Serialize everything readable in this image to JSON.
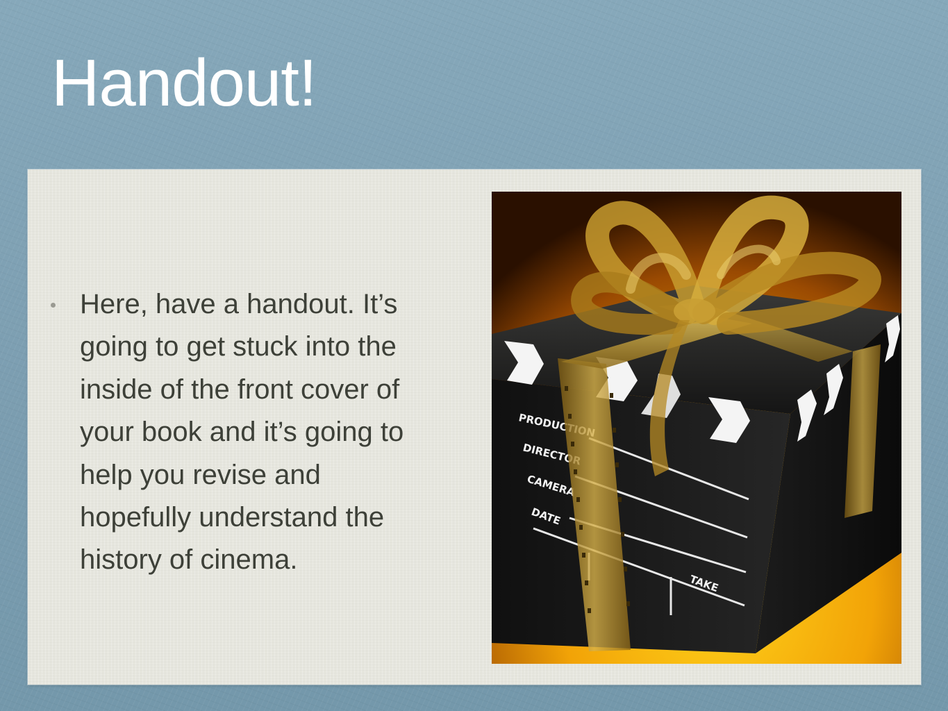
{
  "slide": {
    "title": "Handout!",
    "bullets": [
      {
        "text": "Here, have a handout. It’s going to get stuck into the inside of the front cover of your book and it’s going to help you revise and hopefully understand the history of cinema."
      }
    ]
  },
  "image": {
    "clapperboard_labels": {
      "production": "PRODUCTION",
      "director": "DIRECTOR",
      "camera": "CAMERA",
      "date": "DATE",
      "take": "TAKE"
    }
  },
  "colors": {
    "background": "#7c9fb1",
    "panel": "#e6e6de",
    "title_text": "#ffffff",
    "body_text": "#3d4038",
    "ribbon_gold": "#c8a13a"
  }
}
